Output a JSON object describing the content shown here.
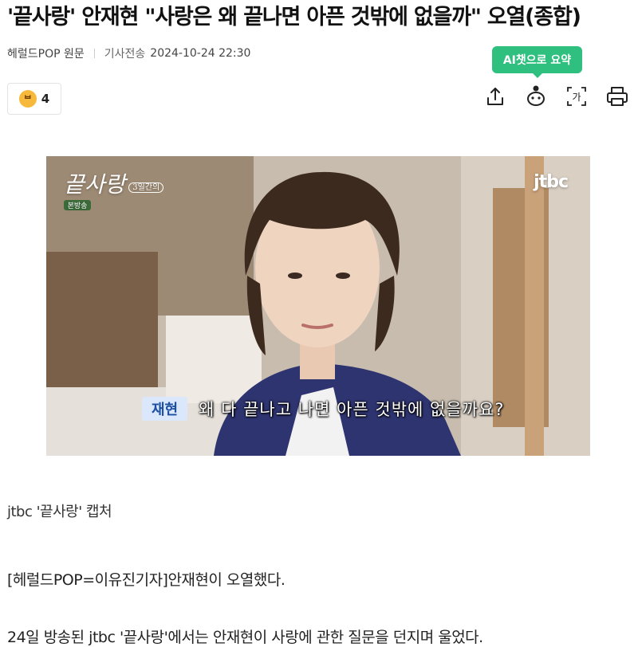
{
  "article": {
    "headline": "'끝사랑' 안재현 \"사랑은 왜 끝나면 아픈 것밖에 없을까\" 오열(종합)",
    "source": "헤럴드POP 원문",
    "sent_label": "기사전송",
    "sent_time": "2024-10-24 22:30"
  },
  "reaction": {
    "icon": "smile-face-icon",
    "glyph": "ᄇ",
    "count": "4"
  },
  "toolbar": {
    "ai_summary_label": "AI챗으로 요약",
    "icons": [
      "share-icon",
      "ai-bot-icon",
      "font-size-icon",
      "print-icon"
    ],
    "font_size_glyph": "가"
  },
  "photo": {
    "show_logo": "끝사랑",
    "show_logo_sub": "3일간의",
    "show_badge": "본방송",
    "broadcaster": "jtbc",
    "caption_speaker": "재현",
    "caption_line": "왜 다 끝나고 나면 아픈 것밖에 없을까요?"
  },
  "body": {
    "photo_credit": "jtbc '끝사랑' 캡처",
    "paragraphs": [
      "[헤럴드POP=이유진기자]안재현이 오열했다.",
      "24일 방송된 jtbc '끝사랑'에서는 안재현이 사랑에 관한 질문을 던지며 울었다."
    ]
  },
  "colors": {
    "accent_green": "#2fbf7e",
    "caption_tag_bg": "#dbe7fb"
  }
}
